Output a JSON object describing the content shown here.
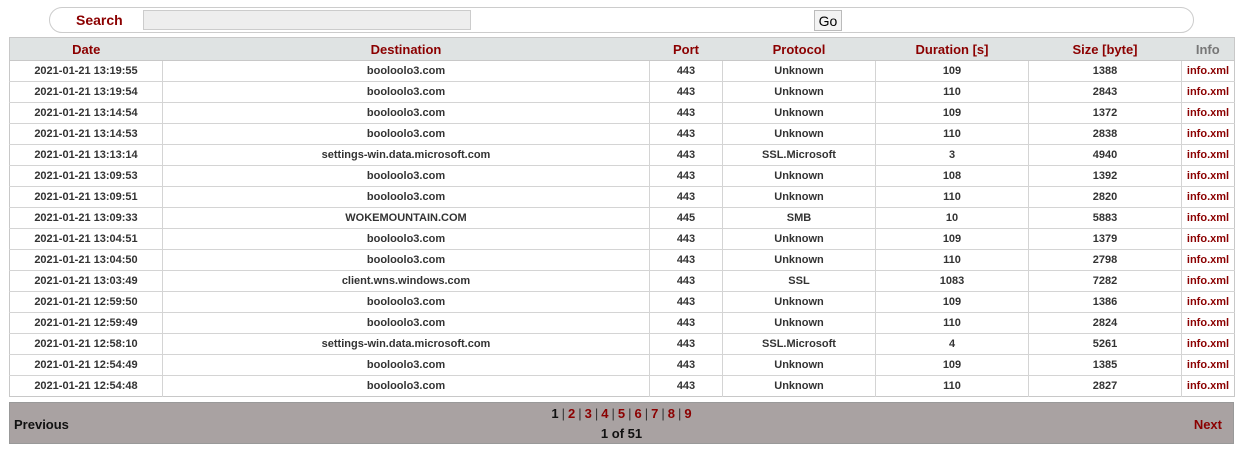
{
  "search": {
    "label": "Search",
    "value": "",
    "go_label": "Go"
  },
  "table": {
    "headers": [
      "Date",
      "Destination",
      "Port",
      "Protocol",
      "Duration [s]",
      "Size [byte]",
      "Info"
    ],
    "rows": [
      [
        "2021-01-21 13:19:55",
        "booloolo3.com",
        "443",
        "Unknown",
        "109",
        "1388",
        "info.xml"
      ],
      [
        "2021-01-21 13:19:54",
        "booloolo3.com",
        "443",
        "Unknown",
        "110",
        "2843",
        "info.xml"
      ],
      [
        "2021-01-21 13:14:54",
        "booloolo3.com",
        "443",
        "Unknown",
        "109",
        "1372",
        "info.xml"
      ],
      [
        "2021-01-21 13:14:53",
        "booloolo3.com",
        "443",
        "Unknown",
        "110",
        "2838",
        "info.xml"
      ],
      [
        "2021-01-21 13:13:14",
        "settings-win.data.microsoft.com",
        "443",
        "SSL.Microsoft",
        "3",
        "4940",
        "info.xml"
      ],
      [
        "2021-01-21 13:09:53",
        "booloolo3.com",
        "443",
        "Unknown",
        "108",
        "1392",
        "info.xml"
      ],
      [
        "2021-01-21 13:09:51",
        "booloolo3.com",
        "443",
        "Unknown",
        "110",
        "2820",
        "info.xml"
      ],
      [
        "2021-01-21 13:09:33",
        "WOKEMOUNTAIN.COM",
        "445",
        "SMB",
        "10",
        "5883",
        "info.xml"
      ],
      [
        "2021-01-21 13:04:51",
        "booloolo3.com",
        "443",
        "Unknown",
        "109",
        "1379",
        "info.xml"
      ],
      [
        "2021-01-21 13:04:50",
        "booloolo3.com",
        "443",
        "Unknown",
        "110",
        "2798",
        "info.xml"
      ],
      [
        "2021-01-21 13:03:49",
        "client.wns.windows.com",
        "443",
        "SSL",
        "1083",
        "7282",
        "info.xml"
      ],
      [
        "2021-01-21 12:59:50",
        "booloolo3.com",
        "443",
        "Unknown",
        "109",
        "1386",
        "info.xml"
      ],
      [
        "2021-01-21 12:59:49",
        "booloolo3.com",
        "443",
        "Unknown",
        "110",
        "2824",
        "info.xml"
      ],
      [
        "2021-01-21 12:58:10",
        "settings-win.data.microsoft.com",
        "443",
        "SSL.Microsoft",
        "4",
        "5261",
        "info.xml"
      ],
      [
        "2021-01-21 12:54:49",
        "booloolo3.com",
        "443",
        "Unknown",
        "109",
        "1385",
        "info.xml"
      ],
      [
        "2021-01-21 12:54:48",
        "booloolo3.com",
        "443",
        "Unknown",
        "110",
        "2827",
        "info.xml"
      ]
    ]
  },
  "pagination": {
    "previous_label": "Previous",
    "next_label": "Next",
    "pages": [
      "1",
      "2",
      "3",
      "4",
      "5",
      "6",
      "7",
      "8",
      "9"
    ],
    "current_page": "1",
    "page_count_text": "1 of 51"
  },
  "colors": {
    "accent": "#8b0000",
    "header_bg": "#dfe3e3",
    "pager_bg": "#a9a2a2"
  }
}
